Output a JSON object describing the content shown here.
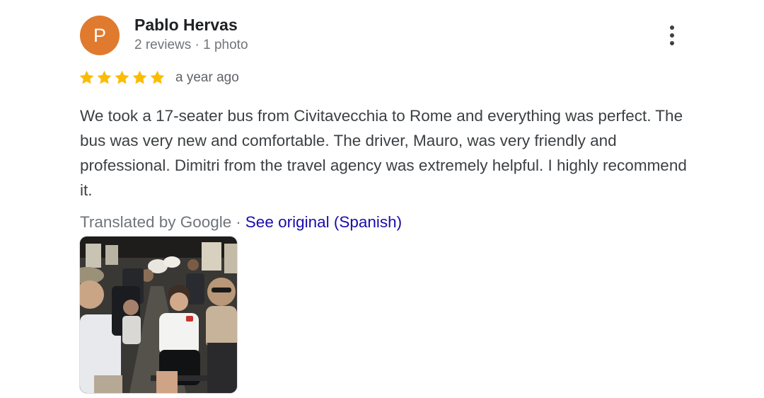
{
  "reviewer": {
    "initial": "P",
    "name": "Pablo Hervas",
    "meta": "2 reviews · 1 photo",
    "avatar_color": "#e07a2f"
  },
  "menu_icon": "more-vert-icon",
  "rating": {
    "stars": 5,
    "max": 5,
    "star_color": "#fbbc04",
    "time_ago": "a year ago"
  },
  "review": {
    "text": "We took a 17-seater bus from Civitavecchia to Rome and everything was perfect. The bus was very new and comfortable. The driver, Mauro, was very friendly and professional. Dimitri from the travel agency was extremely helpful. I highly recommend it."
  },
  "translation": {
    "label": "Translated by Google",
    "separator": "·",
    "link": "See original (Spanish)"
  },
  "photo_icon": "review-photo"
}
